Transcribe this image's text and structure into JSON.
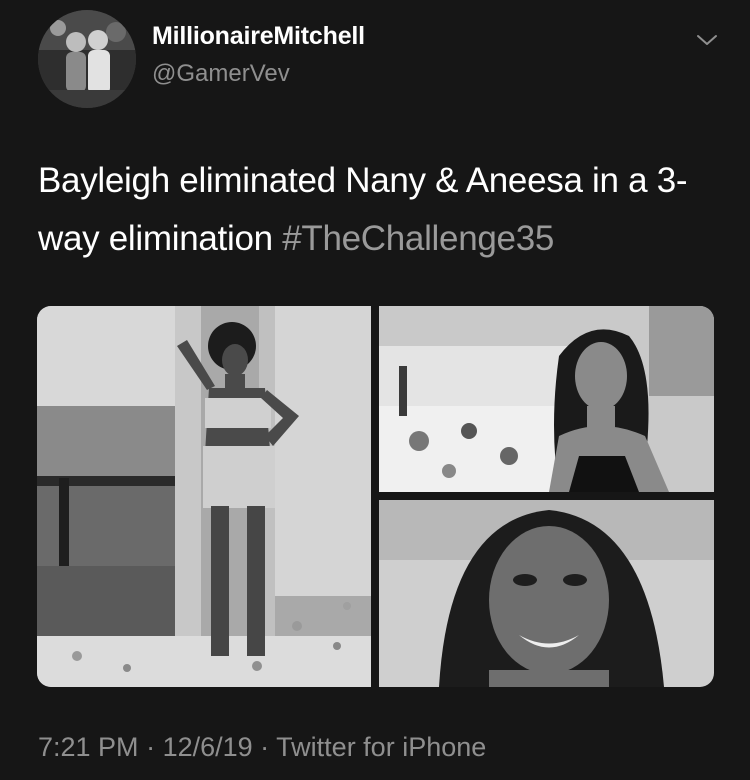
{
  "tweet": {
    "author": {
      "display_name": "MillionaireMitchell",
      "handle": "@GamerVev"
    },
    "text": "Bayleigh eliminated Nany & Aneesa in a 3-way elimination ",
    "hashtag": "#TheChallenge35",
    "meta": {
      "time": "7:21 PM",
      "separator": " · ",
      "date": "12/6/19",
      "source": "Twitter for iPhone"
    },
    "icons": {
      "menu": "chevron-down-icon"
    }
  },
  "colors": {
    "background": "#161616",
    "text_primary": "#ffffff",
    "text_secondary": "#8f8f8f",
    "hashtag": "#9a9a9a"
  }
}
